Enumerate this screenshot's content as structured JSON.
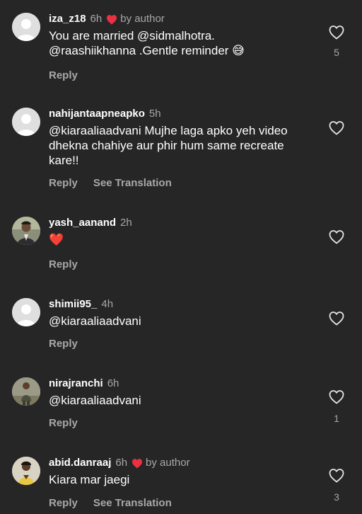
{
  "colors": {
    "background": "#262626",
    "muted": "#a8a8a8",
    "heart": "#ed2f43"
  },
  "comments": [
    {
      "username": "iza_z18",
      "time": "6h",
      "liked_by_author": "by author",
      "text": "You are married @sidmalhotra. @raashiikhanna .Gentle reminder 😅",
      "reply": "Reply",
      "translation": "",
      "like_count": "5",
      "avatar": "default-avatar"
    },
    {
      "username": "nahijantaapneapko",
      "time": "5h",
      "liked_by_author": "",
      "text": "@kiaraaliaadvani Mujhe laga apko yeh video dhekna chahiye aur phir hum same recreate kare!!",
      "reply": "Reply",
      "translation": "See Translation",
      "like_count": "",
      "avatar": "default-avatar"
    },
    {
      "username": "yash_aanand",
      "time": "2h",
      "liked_by_author": "",
      "text": "❤️",
      "reply": "Reply",
      "translation": "",
      "like_count": "",
      "avatar": "photo-avatar"
    },
    {
      "username": "shimii95_",
      "time": "4h",
      "liked_by_author": "",
      "text": "@kiaraaliaadvani",
      "reply": "Reply",
      "translation": "",
      "like_count": "",
      "avatar": "default-avatar"
    },
    {
      "username": "nirajranchi",
      "time": "6h",
      "liked_by_author": "",
      "text": "@kiaraaliaadvani",
      "reply": "Reply",
      "translation": "",
      "like_count": "1",
      "avatar": "photo-avatar"
    },
    {
      "username": "abid.danraaj",
      "time": "6h",
      "liked_by_author": "by author",
      "text": "Kiara mar jaegi",
      "reply": "Reply",
      "translation": "See Translation",
      "like_count": "3",
      "avatar": "photo-avatar"
    }
  ]
}
